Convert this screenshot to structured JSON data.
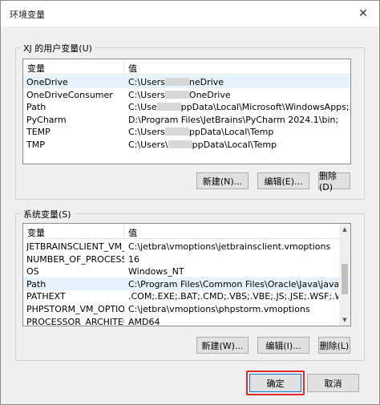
{
  "window": {
    "title": "环境变量",
    "close_glyph": "✕"
  },
  "user_vars": {
    "group_label": "XJ 的用户变量(U)",
    "columns": [
      "变量",
      "值"
    ],
    "rows": [
      {
        "name": "OneDrive",
        "value_pre": "C:\\Users",
        "value_post": "neDrive"
      },
      {
        "name": "OneDriveConsumer",
        "value_pre": "C:\\Users",
        "value_post": "OneDrive"
      },
      {
        "name": "Path",
        "value_pre": "C:\\Use",
        "value_post": "ppData\\Local\\Microsoft\\WindowsApps;;D:\\..."
      },
      {
        "name": "PyCharm",
        "value_pre": "D:\\Program Files\\JetBrains\\PyCharm 2024.1\\bin;",
        "value_post": ""
      },
      {
        "name": "TEMP",
        "value_pre": "C:\\Users",
        "value_post": "ppData\\Local\\Temp"
      },
      {
        "name": "TMP",
        "value_pre": "C:\\Users\\",
        "value_post": "ppData\\Local\\Temp"
      }
    ],
    "buttons": {
      "new": "新建(N)...",
      "edit": "编辑(E)...",
      "delete": "删除(D)"
    }
  },
  "system_vars": {
    "group_label": "系统变量(S)",
    "columns": [
      "变量",
      "值"
    ],
    "rows": [
      {
        "name": "JETBRAINSCLIENT_VM_O...",
        "value": "C:\\jetbra\\vmoptions\\jetbrainsclient.vmoptions"
      },
      {
        "name": "NUMBER_OF_PROCESSORS",
        "value": "16"
      },
      {
        "name": "OS",
        "value": "Windows_NT"
      },
      {
        "name": "Path",
        "value": "C:\\Program Files\\Common Files\\Oracle\\Java\\javapath;D:\\Pro..."
      },
      {
        "name": "PATHEXT",
        "value": ".COM;.EXE;.BAT;.CMD;.VBS;.VBE;.JS;.JSE;.WSF;.WSH;.MSC;.PY;.P..."
      },
      {
        "name": "PHPSTORM_VM_OPTIONS",
        "value": "C:\\jetbra\\vmoptions\\phpstorm.vmoptions"
      },
      {
        "name": "PROCESSOR_ARCHITECT...",
        "value": "AMD64"
      }
    ],
    "buttons": {
      "new": "新建(W)...",
      "edit": "编辑(I)...",
      "delete": "删除(L)"
    }
  },
  "footer": {
    "ok": "确定",
    "cancel": "取消"
  },
  "colors": {
    "selected_row": "#e5f3ff",
    "highlight_box": "#e0282b"
  }
}
